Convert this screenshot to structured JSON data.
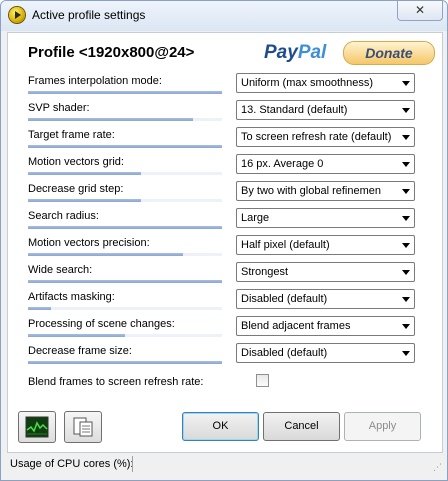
{
  "window": {
    "title": "Active profile settings",
    "close_label": "✕"
  },
  "profile": {
    "title": "Profile <1920x800@24>"
  },
  "donate": {
    "paypal_pay": "Pay",
    "paypal_pal": "Pal",
    "label": "Donate"
  },
  "settings": [
    {
      "label": "Frames interpolation mode:",
      "value": "Uniform (max smoothness)",
      "level": 1.0
    },
    {
      "label": "SVP shader:",
      "value": "13. Standard (default)",
      "level": 0.85
    },
    {
      "label": "Target frame rate:",
      "value": "To screen refresh rate (default)",
      "level": 1.0
    },
    {
      "label": "Motion vectors grid:",
      "value": "16 px. Average 0",
      "level": 0.58
    },
    {
      "label": "Decrease grid step:",
      "value": "By two with global refinemen",
      "level": 0.58
    },
    {
      "label": "Search radius:",
      "value": "Large",
      "level": 1.0
    },
    {
      "label": "Motion vectors precision:",
      "value": "Half pixel (default)",
      "level": 0.8
    },
    {
      "label": "Wide search:",
      "value": "Strongest",
      "level": 1.0
    },
    {
      "label": "Artifacts masking:",
      "value": "Disabled (default)",
      "level": 0.12
    },
    {
      "label": "Processing of scene changes:",
      "value": "Blend adjacent frames",
      "level": 0.5
    },
    {
      "label": "Decrease frame size:",
      "value": "Disabled (default)",
      "level": 1.0
    }
  ],
  "blend": {
    "label": "Blend frames to screen refresh rate:",
    "checked": false
  },
  "buttons": {
    "ok": "OK",
    "cancel": "Cancel",
    "apply": "Apply"
  },
  "toolbar": {
    "graph_icon": "graph-icon",
    "clipboard_icon": "clipboard-icon"
  },
  "status": {
    "cpu_label": "Usage of CPU cores (%):"
  }
}
